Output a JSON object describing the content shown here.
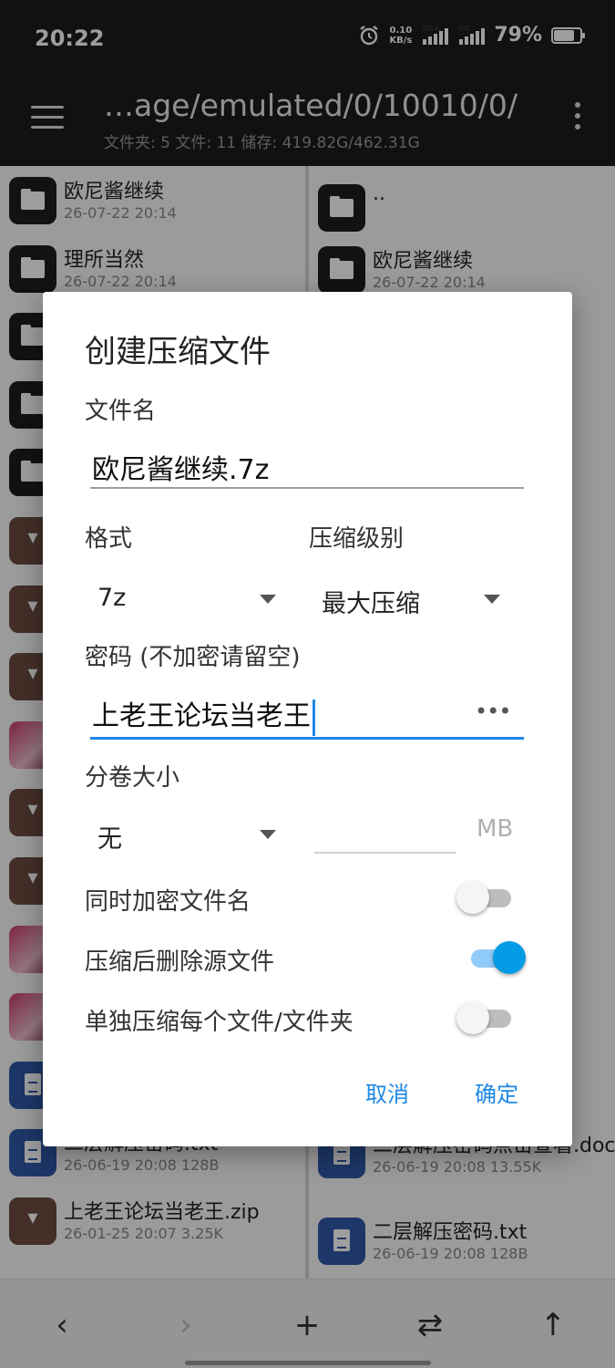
{
  "status": {
    "time": "20:22",
    "speed_value": "0.10",
    "speed_unit": "KB/s",
    "sim1": "5GA",
    "sim2": "5G",
    "battery": "79%",
    "battery_level": 0.79
  },
  "appbar": {
    "path": "…age/emulated/0/10010/0/",
    "stats": "文件夹: 5  文件: 11  储存: 419.82G/462.31G"
  },
  "left_pane": [
    {
      "name": "欧尼酱继续",
      "meta": "26-07-22 20:14",
      "icon": "folder"
    },
    {
      "name": "理所当然",
      "meta": "26-07-22 20:14",
      "icon": "folder"
    },
    {
      "name": "",
      "meta": "",
      "icon": "folder"
    },
    {
      "name": "",
      "meta": "",
      "icon": "folder"
    },
    {
      "name": "",
      "meta": "",
      "icon": "folder"
    },
    {
      "name": "",
      "meta": "",
      "icon": "archive"
    },
    {
      "name": "",
      "meta": "",
      "icon": "archive"
    },
    {
      "name": "",
      "meta": "",
      "icon": "archive"
    },
    {
      "name": "",
      "meta": "",
      "icon": "thumb"
    },
    {
      "name": "",
      "meta": "",
      "icon": "archive"
    },
    {
      "name": "",
      "meta": "",
      "icon": "archive"
    },
    {
      "name": "",
      "meta": "",
      "icon": "thumb"
    },
    {
      "name": "",
      "meta": "",
      "icon": "thumb"
    },
    {
      "name": "",
      "meta": "",
      "icon": "doc"
    },
    {
      "name": "二层解压密码.txt",
      "meta": "26-06-19 20:08  128B",
      "icon": "doc"
    },
    {
      "name": "上老王论坛当老王.zip",
      "meta": "26-01-25 20:07  3.25K",
      "icon": "archive"
    }
  ],
  "right_pane": [
    {
      "name": "..",
      "meta": "",
      "icon": "folder"
    },
    {
      "name": "欧尼酱继续",
      "meta": "26-07-22 20:14",
      "icon": "folder"
    },
    {
      "name": "二层解压密码点击查看.docx",
      "meta": "26-06-19 20:08  13.55K",
      "icon": "doc"
    },
    {
      "name": "二层解压密码.txt",
      "meta": "26-06-19 20:08  128B",
      "icon": "doc"
    }
  ],
  "dialog": {
    "title": "创建压缩文件",
    "filename_label": "文件名",
    "filename_value": "欧尼酱继续.7z",
    "format_label": "格式",
    "format_value": "7z",
    "level_label": "压缩级别",
    "level_value": "最大压缩",
    "password_label": "密码 (不加密请留空)",
    "password_value": "上老王论坛当老王",
    "volume_label": "分卷大小",
    "volume_value": "无",
    "volume_size": "",
    "volume_unit": "MB",
    "encrypt_names_label": "同时加密文件名",
    "encrypt_names_on": false,
    "delete_source_label": "压缩后删除源文件",
    "delete_source_on": true,
    "separate_label": "单独压缩每个文件/文件夹",
    "separate_on": false,
    "cancel": "取消",
    "ok": "确定"
  },
  "bottombar": {
    "back": "‹",
    "forward": "›",
    "add": "+",
    "swap": "⇄",
    "up": "↑"
  }
}
